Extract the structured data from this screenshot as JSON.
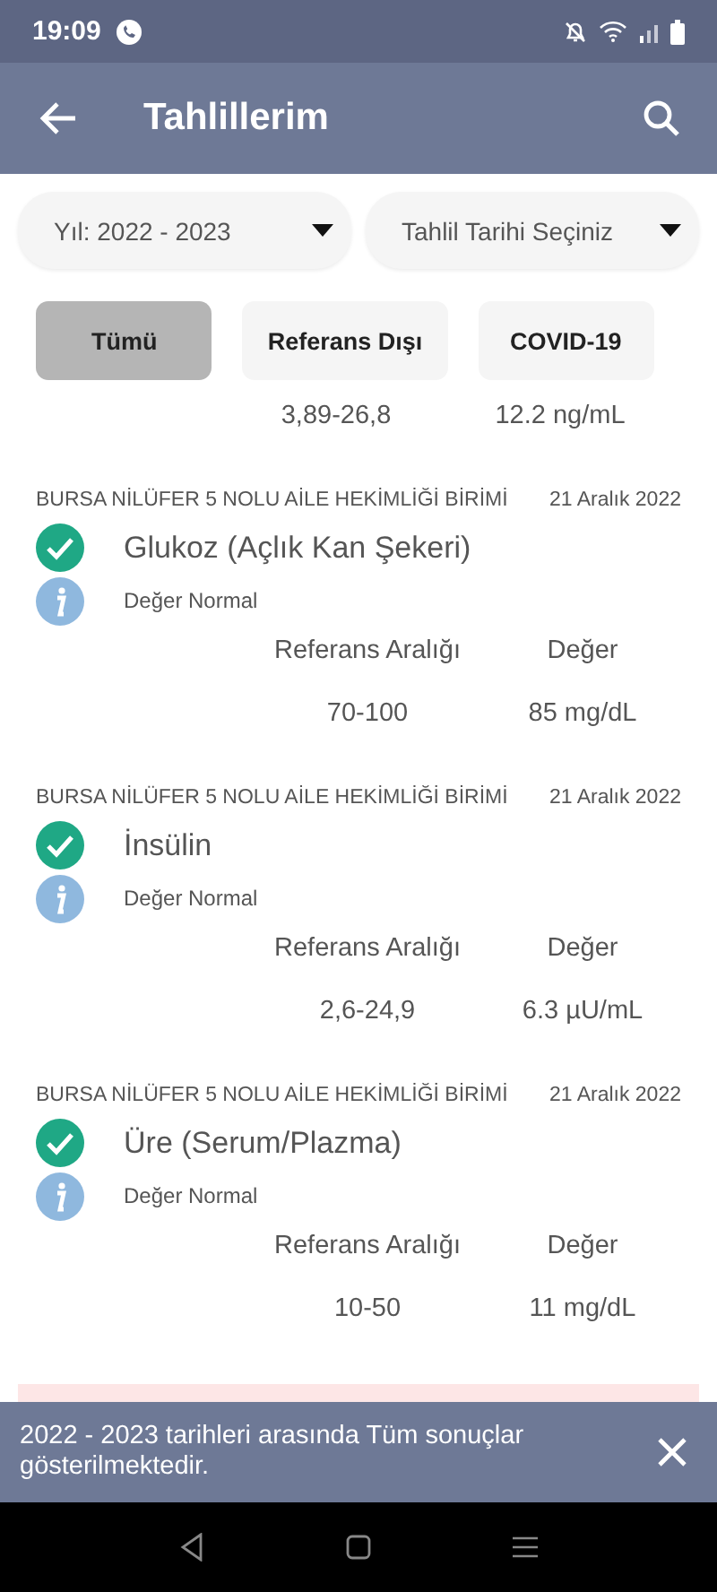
{
  "status_bar": {
    "time": "19:09"
  },
  "app_bar": {
    "title": "Tahlillerim"
  },
  "filters": [
    {
      "value": "Yıl: 2022 - 2023"
    },
    {
      "value": "Tahlil Tarihi Seçiniz"
    }
  ],
  "chips": [
    {
      "label": "Tümü",
      "selected": true
    },
    {
      "label": "Referans Dışı",
      "selected": false
    },
    {
      "label": "COVID-19",
      "selected": false
    }
  ],
  "partial_row": {
    "range": "3,89-26,8",
    "value": "12.2 ng/mL"
  },
  "results": [
    {
      "place": "BURSA NİLÜFER 5 NOLU AİLE HEKİMLİĞİ BİRİMİ",
      "date": "21 Aralık 2022",
      "name": "Glukoz (Açlık Kan Şekeri)",
      "normal": true,
      "note": "Değer Normal",
      "range_label": "Referans Aralığı",
      "value_label": "Değer",
      "range": "70-100",
      "value": "85 mg/dL"
    },
    {
      "place": "BURSA NİLÜFER 5 NOLU AİLE HEKİMLİĞİ BİRİMİ",
      "date": "21 Aralık 2022",
      "name": "İnsülin",
      "normal": true,
      "note": "Değer Normal",
      "range_label": "Referans Aralığı",
      "value_label": "Değer",
      "range": "2,6-24,9",
      "value": "6.3 µU/mL"
    },
    {
      "place": "BURSA NİLÜFER 5 NOLU AİLE HEKİMLİĞİ BİRİMİ",
      "date": "21 Aralık 2022",
      "name": "Üre (Serum/Plazma)",
      "normal": true,
      "note": "Değer Normal",
      "range_label": "Referans Aralığı",
      "value_label": "Değer",
      "range": "10-50",
      "value": "11 mg/dL"
    }
  ],
  "snackbar": {
    "message": "2022 - 2023 tarihleri arasında Tüm sonuçlar gösterilmektedir."
  }
}
